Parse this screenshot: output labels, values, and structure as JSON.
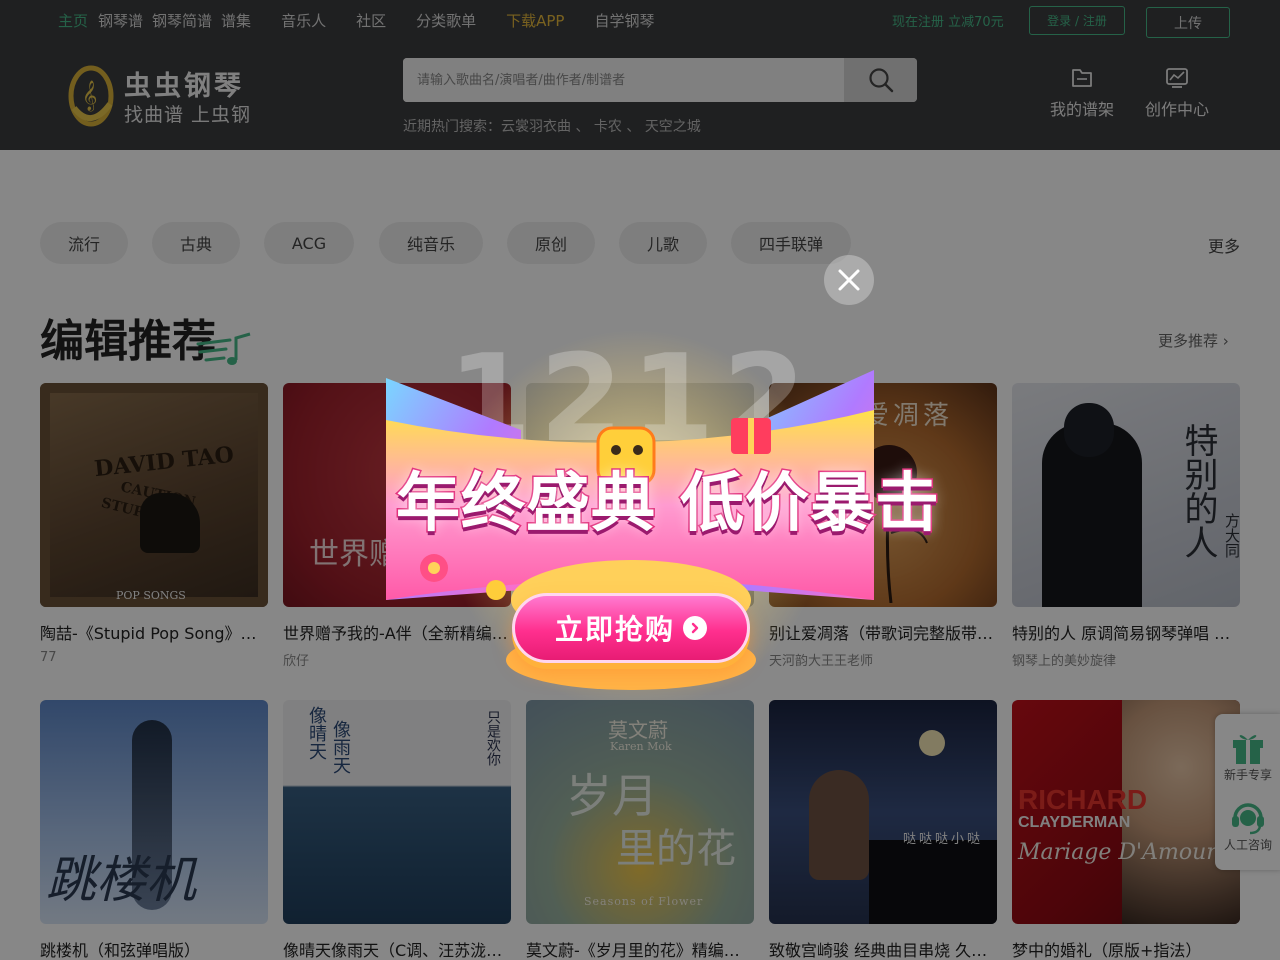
{
  "topnav": {
    "items": [
      "主页",
      "钢琴谱",
      "钢琴简谱",
      "谱集",
      "音乐人",
      "社区",
      "分类歌单",
      "下载APP",
      "自学钢琴"
    ],
    "promo": "现在注册 立减70元",
    "login": "登录 / 注册",
    "upload": "上传"
  },
  "header": {
    "logo_name": "虫虫钢琴",
    "logo_slogan": "找曲谱 上虫钢",
    "search_placeholder": "请输入歌曲名/演唱者/曲作者/制谱者",
    "hot_label": "近期热门搜索：",
    "hot_terms": [
      "云裳羽衣曲",
      "卡农",
      "天空之城"
    ],
    "hot_sep": "、",
    "my_shelf": "我的谱架",
    "creator": "创作中心"
  },
  "categories": {
    "items": [
      "流行",
      "古典",
      "ACG",
      "纯音乐",
      "原创",
      "儿歌",
      "四手联弹"
    ],
    "more": "更多"
  },
  "section": {
    "title": "编辑推荐",
    "more": "更多推荐 ›"
  },
  "cards": [
    {
      "title": "陶喆-《Stupid Pop Song》钢琴谱",
      "author": "77",
      "cover_text": [
        "DAVID TAO",
        "CAUTION",
        "STUPID POP",
        "POP SONGS"
      ]
    },
    {
      "title": "世界赠予我的-A伴（全新精编版）",
      "author": "欣仔",
      "cover_text": [
        "世界赠"
      ]
    },
    {
      "title": "",
      "author": "",
      "cover_text": []
    },
    {
      "title": "别让爱凋落（带歌词完整版带…",
      "author": "天河韵大王王老师",
      "cover_text": [
        "别让爱凋落"
      ]
    },
    {
      "title": "特别的人 原调简易钢琴弹唱 …",
      "author": "钢琴上的美妙旋律",
      "cover_text": [
        "特别的人",
        "方大同"
      ]
    },
    {
      "title": "跳楼机（和弦弹唱版）",
      "author": "",
      "cover_text": [
        "跳楼机"
      ]
    },
    {
      "title": "像晴天像雨天（C调、汪苏泷…",
      "author": "",
      "cover_text": [
        "像晴天",
        "像雨天",
        "只是欢你"
      ]
    },
    {
      "title": "莫文蔚-《岁月里的花》精编…",
      "author": "",
      "cover_text": [
        "莫文蔚",
        "Karen Mok",
        "岁月",
        "里的花",
        "Seasons of Flower"
      ]
    },
    {
      "title": "致敬宫崎骏 经典曲目串烧 久…",
      "author": "",
      "cover_text": [
        "哒哒哒小哒"
      ]
    },
    {
      "title": "梦中的婚礼（原版+指法）",
      "author": "",
      "cover_text": [
        "RICHARD",
        "CLAYDERMAN",
        "Mariage D'Amour"
      ]
    }
  ],
  "sidefloat": {
    "newbie": "新手专享",
    "support": "人工咨询"
  },
  "modal": {
    "headline_left": "年终盛典",
    "headline_right": "低价暴击",
    "cta": "立即抢购",
    "deco_number": "1212"
  },
  "colors": {
    "brand_green": "#46b989",
    "nav_gold": "#e6b93c",
    "header_bg": "#3c3d3f",
    "cta_pink": "#ff2f8e"
  },
  "icons": [
    "search-icon",
    "shelf-icon",
    "creator-chart-icon",
    "gift-icon",
    "headset-icon",
    "close-icon",
    "arrow-right-icon",
    "logo-icon"
  ]
}
